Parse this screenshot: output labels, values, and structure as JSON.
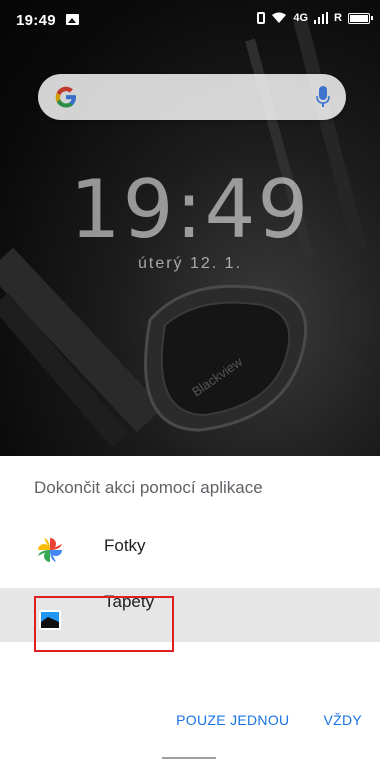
{
  "status_bar": {
    "time": "19:49",
    "network_label": "4G",
    "signal_label": "R"
  },
  "home": {
    "clock_time": "19:49",
    "date": "úterý 12. 1.",
    "brand_text": "Blackview"
  },
  "chooser": {
    "title": "Dokončit akci pomocí aplikace",
    "apps": [
      {
        "label": "Fotky",
        "icon": "google-photos-icon"
      },
      {
        "label": "Tapety",
        "icon": "wallpapers-icon"
      }
    ],
    "selected_index": 1,
    "actions": {
      "once": "POUZE JEDNOU",
      "always": "VŽDY"
    }
  },
  "colors": {
    "accent": "#1a73e8",
    "highlight_border": "#e02020",
    "selected_row": "#e6e6e6",
    "title_text": "#5f6368"
  }
}
